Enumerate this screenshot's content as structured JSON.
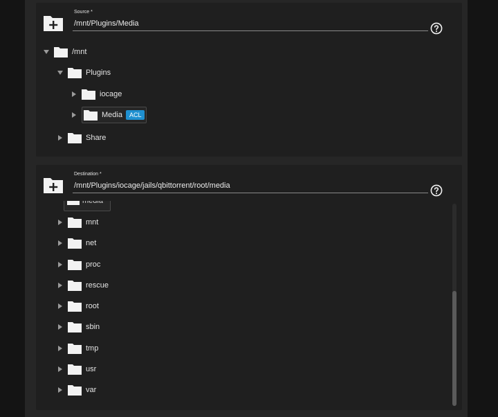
{
  "source": {
    "label": "Source *",
    "value": "/mnt/Plugins/Media",
    "tree": [
      {
        "label": "/mnt",
        "expanded": true
      },
      {
        "label": "Plugins",
        "expanded": true
      },
      {
        "label": "iocage",
        "expanded": false
      },
      {
        "label": "Media",
        "expanded": false,
        "badge": "ACL",
        "selected": true
      },
      {
        "label": "Share",
        "expanded": false
      }
    ]
  },
  "destination": {
    "label": "Destination *",
    "value": "/mnt/Plugins/iocage/jails/qbittorrent/root/media",
    "partial_item": "media",
    "tree": [
      {
        "label": "mnt"
      },
      {
        "label": "net"
      },
      {
        "label": "proc"
      },
      {
        "label": "rescue"
      },
      {
        "label": "root"
      },
      {
        "label": "sbin"
      },
      {
        "label": "tmp"
      },
      {
        "label": "usr"
      },
      {
        "label": "var"
      }
    ]
  },
  "colors": {
    "accent": "#1f90d0",
    "background": "#1f1f1f",
    "text": "#e6e6e6"
  },
  "icons": {
    "folder_add": "folder-plus-icon",
    "help": "help-circle-icon",
    "folder": "folder-icon",
    "caret_right": "caret-right-icon",
    "caret_down": "caret-down-icon"
  }
}
